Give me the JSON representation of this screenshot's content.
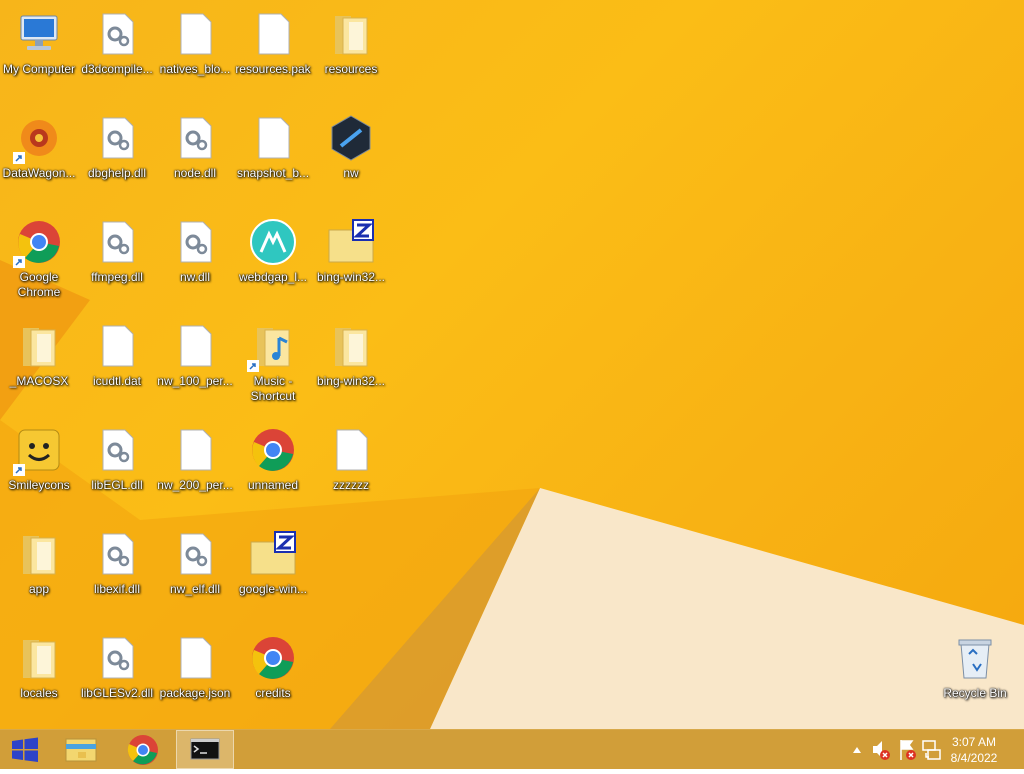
{
  "desktop": {
    "icons": [
      {
        "label": "My Computer",
        "icon": "computer-icon"
      },
      {
        "label": "DataWagon...",
        "icon": "datawagon-icon"
      },
      {
        "label": "Google Chrome",
        "icon": "chrome-icon"
      },
      {
        "label": "_MACOSX",
        "icon": "folder-icon"
      },
      {
        "label": "Smileycons",
        "icon": "smiley-icon"
      },
      {
        "label": "app",
        "icon": "folder-icon"
      },
      {
        "label": "locales",
        "icon": "folder-icon"
      },
      {
        "label": "d3dcompile...",
        "icon": "dll-file-icon"
      },
      {
        "label": "dbghelp.dll",
        "icon": "dll-file-icon"
      },
      {
        "label": "ffmpeg.dll",
        "icon": "dll-file-icon"
      },
      {
        "label": "icudtl.dat",
        "icon": "blank-file-icon"
      },
      {
        "label": "libEGL.dll",
        "icon": "dll-file-icon"
      },
      {
        "label": "libexif.dll",
        "icon": "dll-file-icon"
      },
      {
        "label": "libGLESv2.dll",
        "icon": "dll-file-icon"
      },
      {
        "label": "natives_blo...",
        "icon": "blank-file-icon"
      },
      {
        "label": "node.dll",
        "icon": "dll-file-icon"
      },
      {
        "label": "nw.dll",
        "icon": "dll-file-icon"
      },
      {
        "label": "nw_100_per...",
        "icon": "blank-file-icon"
      },
      {
        "label": "nw_200_per...",
        "icon": "blank-file-icon"
      },
      {
        "label": "nw_elf.dll",
        "icon": "dll-file-icon"
      },
      {
        "label": "package.json",
        "icon": "blank-file-icon"
      },
      {
        "label": "resources.pak",
        "icon": "blank-file-icon"
      },
      {
        "label": "snapshot_b...",
        "icon": "blank-file-icon"
      },
      {
        "label": "webdgap_l...",
        "icon": "webdgap-icon"
      },
      {
        "label": "Music - Shortcut",
        "icon": "music-folder-icon"
      },
      {
        "label": "unnamed",
        "icon": "chrome-icon"
      },
      {
        "label": "google-win...",
        "icon": "zip-folder-icon"
      },
      {
        "label": "credits",
        "icon": "chrome-icon"
      },
      {
        "label": "resources",
        "icon": "folder-icon"
      },
      {
        "label": "nw",
        "icon": "nw-icon"
      },
      {
        "label": "bing-win32...",
        "icon": "zip-folder-icon"
      },
      {
        "label": "bing-win32...",
        "icon": "folder-icon"
      },
      {
        "label": "zzzzzz",
        "icon": "blank-file-icon"
      },
      {
        "label": "Recycle Bin",
        "icon": "recycle-bin-icon"
      }
    ]
  },
  "taskbar": {
    "start_icon": "windows-logo-icon",
    "pinned": [
      {
        "name": "file-explorer",
        "icon": "file-explorer-icon"
      },
      {
        "name": "chrome",
        "icon": "chrome-icon"
      },
      {
        "name": "command-prompt",
        "icon": "command-prompt-icon",
        "active": true
      }
    ],
    "tray": {
      "icons": [
        "show-hidden-icons-icon",
        "volume-muted-icon",
        "action-center-flag-icon",
        "network-icon"
      ],
      "time": "3:07 AM",
      "date": "8/4/2022"
    }
  }
}
